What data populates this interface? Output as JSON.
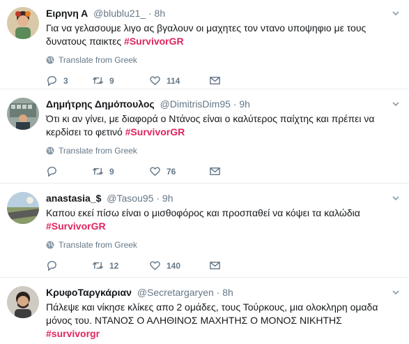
{
  "translate_label": "Translate from Greek",
  "colors": {
    "hashtag": "#e0245e",
    "secondary": "#657786",
    "divider": "#e6ecf0"
  },
  "tweets": [
    {
      "name": "Ειρηνη Α",
      "handle": "@blublu21_",
      "dot": "·",
      "time": "8h",
      "text": "Για να γελασουμε λιγο ας βγαλουν οι μαχητες τον ντανο υποψηφιο με τους δυνατους παικτες",
      "hashtag": "#SurvivorGR",
      "replies": "3",
      "retweets": "9",
      "likes": "114"
    },
    {
      "name": "Δημήτρης Δημόπουλος",
      "handle": "@DimitrisDim95",
      "dot": "·",
      "time": "9h",
      "text": "Ότι κι αν γίνει, με διαφορά ο Ντάνος είναι ο καλύτερος παίχτης και πρέπει να κερδίσει το φετινό",
      "hashtag": "#SurvivorGR",
      "replies": "",
      "retweets": "9",
      "likes": "76"
    },
    {
      "name": "anastasia_$",
      "handle": "@Tasou95",
      "dot": "·",
      "time": "9h",
      "text": "Καπου εκεί πίσω είναι ο μισθοφόρος και προσπαθεί να κόψει τα καλώδια",
      "hashtag": "#SurvivorGR",
      "replies": "",
      "retweets": "12",
      "likes": "140"
    },
    {
      "name": "ΚρυφοΤαργκάριαν",
      "handle": "@Secretargaryen",
      "dot": "·",
      "time": "8h",
      "text": "Πάλεψε και νίκησε κλίκες απο 2 ομάδες, τους Τούρκους, μια ολοκληρη ομαδα μόνος του. ΝΤΑΝΟΣ Ο ΑΛΗΘΙΝΟΣ ΜΑΧΗΤΗΣ Ο ΜΟΝΟΣ ΝΙΚΗΤΗΣ",
      "hashtag": "#survivorgr",
      "replies": "",
      "retweets": "",
      "likes": ""
    }
  ]
}
